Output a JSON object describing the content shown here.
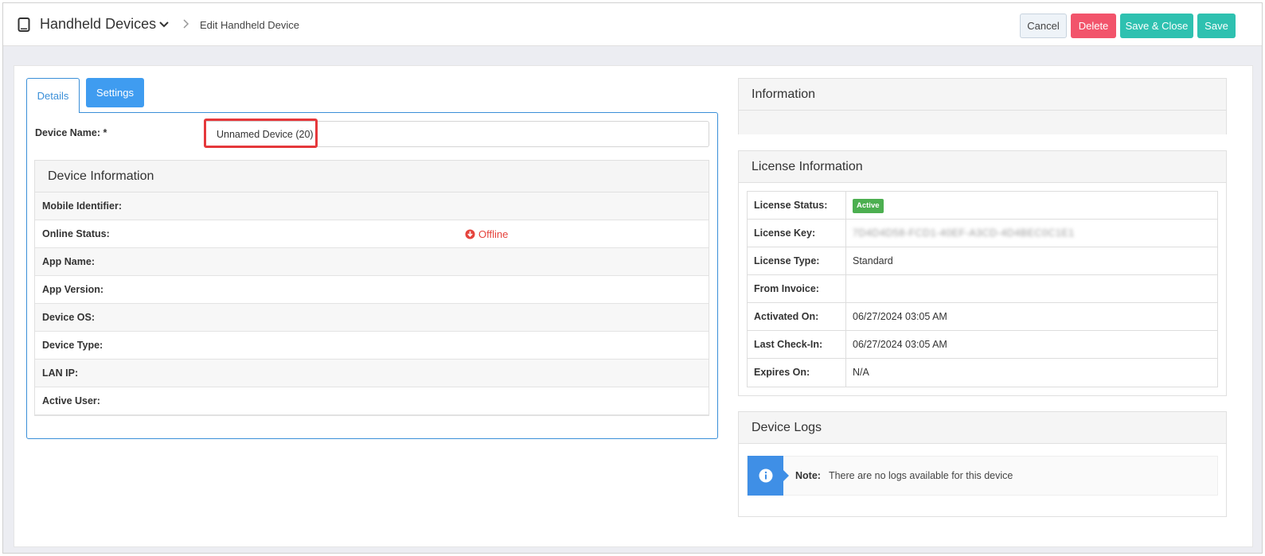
{
  "header": {
    "app_title": "Handheld Devices",
    "breadcrumb": "Edit Handheld Device",
    "buttons": {
      "cancel": "Cancel",
      "delete": "Delete",
      "save_close": "Save & Close",
      "save": "Save"
    }
  },
  "tabs": {
    "details": "Details",
    "settings": "Settings"
  },
  "form": {
    "device_name_label": "Device Name: *",
    "device_name_value": "Unnamed Device (20)"
  },
  "device_info": {
    "title": "Device Information",
    "rows": [
      {
        "label": "Mobile Identifier:",
        "value": ""
      },
      {
        "label": "Online Status:",
        "value": "Offline"
      },
      {
        "label": "App Name:",
        "value": ""
      },
      {
        "label": "App Version:",
        "value": ""
      },
      {
        "label": "Device OS:",
        "value": ""
      },
      {
        "label": "Device Type:",
        "value": ""
      },
      {
        "label": "LAN IP:",
        "value": ""
      },
      {
        "label": "Active User:",
        "value": ""
      }
    ]
  },
  "information": {
    "title": "Information"
  },
  "license": {
    "title": "License Information",
    "rows": [
      {
        "label": "License Status:",
        "value": "Active"
      },
      {
        "label": "License Key:",
        "value": "7D4D4D58-FCD1-40EF-A3CD-4D4BEC0C1E1"
      },
      {
        "label": "License Type:",
        "value": "Standard"
      },
      {
        "label": "From Invoice:",
        "value": ""
      },
      {
        "label": "Activated On:",
        "value": "06/27/2024 03:05 AM"
      },
      {
        "label": "Last Check-In:",
        "value": "06/27/2024 03:05 AM"
      },
      {
        "label": "Expires On:",
        "value": "N/A"
      }
    ]
  },
  "logs": {
    "title": "Device Logs",
    "note_label": "Note:",
    "note_text": "There are no logs available for this device"
  },
  "colors": {
    "primary": "#3f9cf0",
    "delete": "#f2546b",
    "save": "#2ec1b0",
    "offline": "#e5443d",
    "active_badge": "#4caf50"
  }
}
